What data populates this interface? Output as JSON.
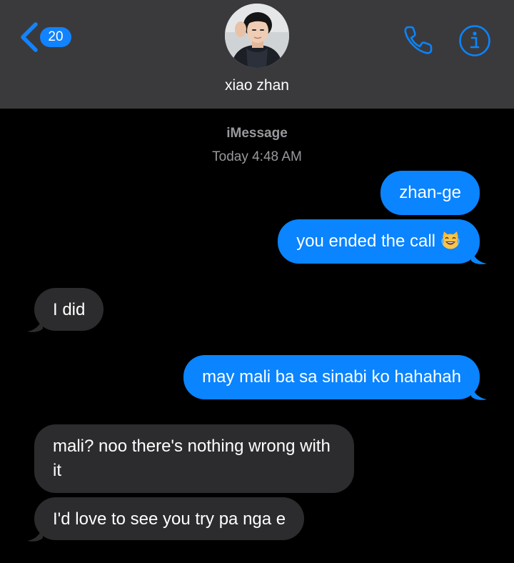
{
  "header": {
    "unread_count": "20",
    "contact_name": "xiao zhan"
  },
  "conversation": {
    "service": "iMessage",
    "timestamp": "Today 4:48 AM",
    "messages": [
      {
        "direction": "sent",
        "text": "zhan-ge"
      },
      {
        "direction": "sent",
        "text": "you ended the call",
        "emoji": "laughing-cat-with-tears-icon"
      },
      {
        "direction": "received",
        "text": "I did"
      },
      {
        "direction": "sent",
        "text": "may mali ba sa sinabi ko hahahah"
      },
      {
        "direction": "received",
        "text": "mali? noo there's nothing wrong with it"
      },
      {
        "direction": "received",
        "text": "I'd love to see you try pa nga e"
      }
    ]
  },
  "colors": {
    "header_bg": "#3a3a3c",
    "accent": "#0a84ff",
    "sent_bubble": "#0a84ff",
    "received_bubble": "#2c2c2e",
    "meta_text": "#98989d",
    "background": "#000000"
  },
  "icons": {
    "back": "chevron-left-icon",
    "phone": "phone-icon",
    "info": "info-icon"
  }
}
